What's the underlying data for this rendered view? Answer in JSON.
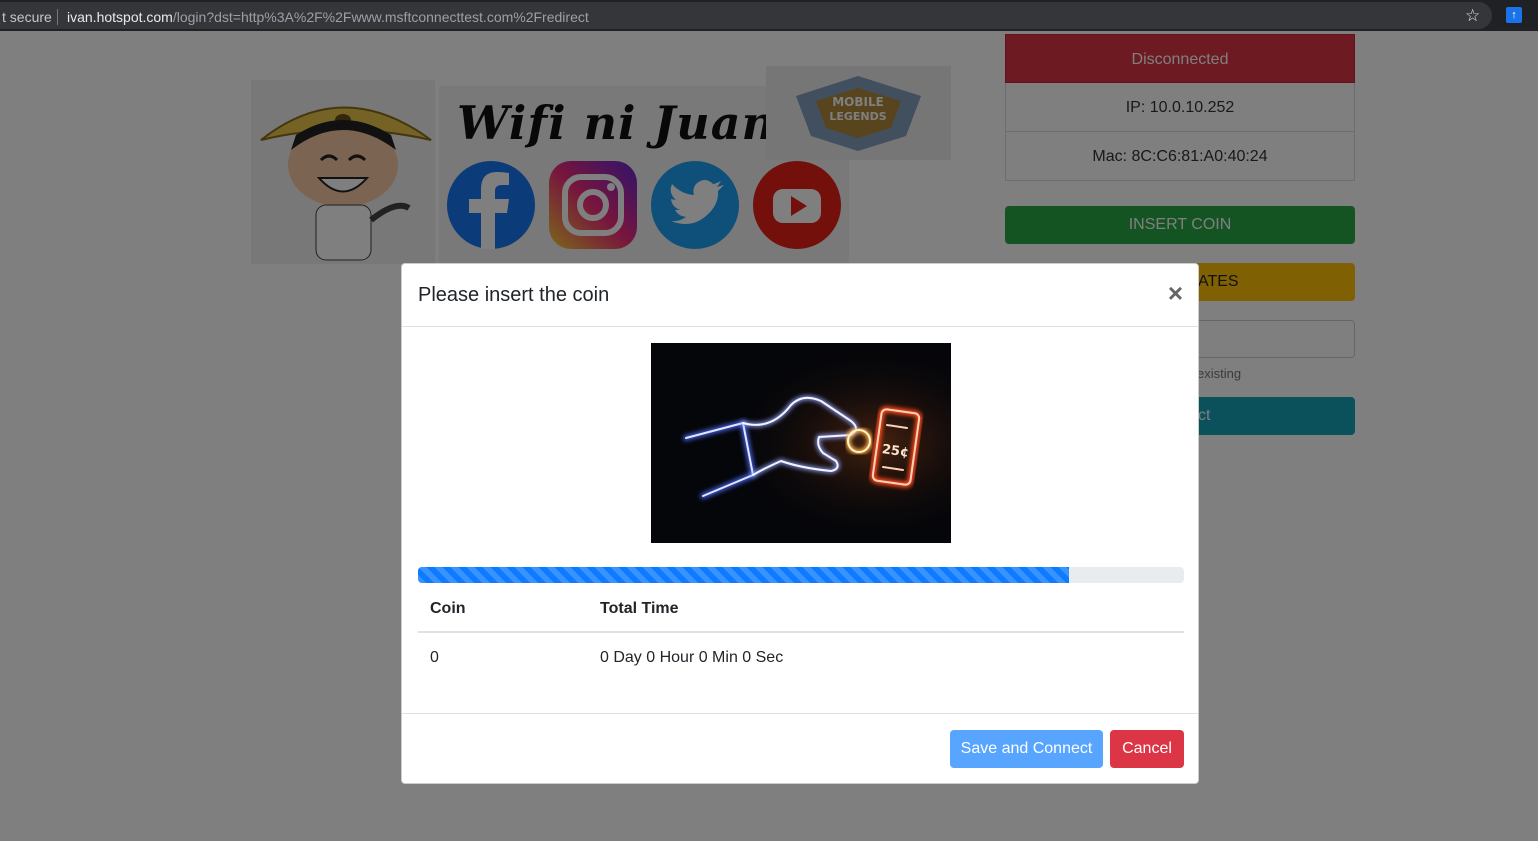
{
  "browser": {
    "security_label": "t secure",
    "url_host": "ivan.hotspot.com",
    "url_path": "/login?dst=http%3A%2F%2Fwww.msftconnecttest.com%2Fredirect"
  },
  "banner": {
    "brand_text": "Wifi ni Juan",
    "social_icons": [
      "facebook-icon",
      "instagram-icon",
      "twitter-icon",
      "youtube-icon"
    ],
    "game_logo_text": "MOBILE LEGENDS"
  },
  "side": {
    "status": "Disconnected",
    "ip": "IP: 10.0.10.252",
    "mac": "Mac: 8C:C6:81:A0:40:24",
    "insert_coin": "INSERT COIN",
    "rates_partial": "ATES",
    "hint_partial": "existing",
    "connect_partial": "ct"
  },
  "modal": {
    "title": "Please insert the coin",
    "close_symbol": "×",
    "progress_percent": 85,
    "table": {
      "headers": [
        "Coin",
        "Total Time"
      ],
      "rows": [
        [
          "0",
          "0 Day 0 Hour 0 Min 0 Sec"
        ]
      ]
    },
    "save_label": "Save and Connect",
    "cancel_label": "Cancel"
  },
  "colors": {
    "disconnected": "#dc3545",
    "insert_coin": "#28a745",
    "rates": "#ffc107",
    "connect": "#17a2b8",
    "progress": "#0d7bff"
  }
}
